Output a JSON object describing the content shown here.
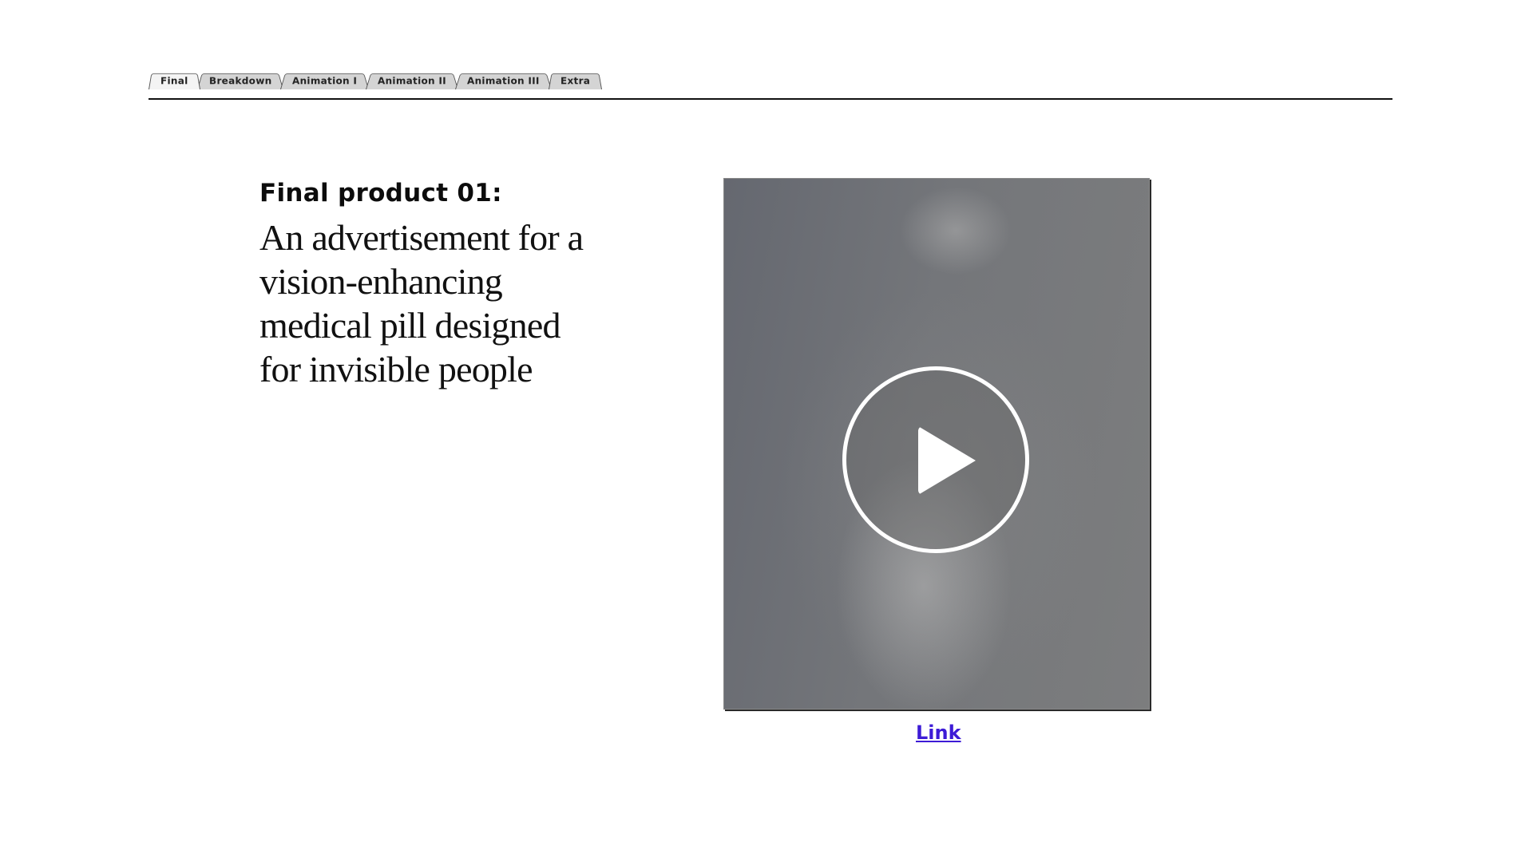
{
  "tabs": [
    {
      "label": "Final",
      "active": true
    },
    {
      "label": "Breakdown",
      "active": false
    },
    {
      "label": "Animation I",
      "active": false
    },
    {
      "label": "Animation II",
      "active": false
    },
    {
      "label": "Animation III",
      "active": false
    },
    {
      "label": "Extra",
      "active": false
    }
  ],
  "content": {
    "heading": "Final product 01:",
    "description": "An advertisement for a vision-enhancing medical pill designed for invisible people"
  },
  "video": {
    "play_icon": "play-icon"
  },
  "link": {
    "label": "Link",
    "color": "#3d1bd6"
  }
}
